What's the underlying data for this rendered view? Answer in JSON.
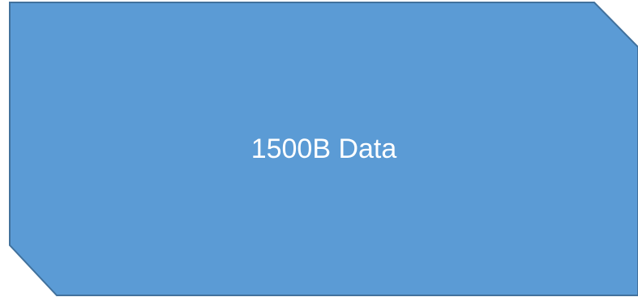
{
  "shape": {
    "label": "1500B Data",
    "fill_color": "#5b9bd5",
    "stroke_color": "#41719c",
    "label_color": "#ffffff"
  }
}
